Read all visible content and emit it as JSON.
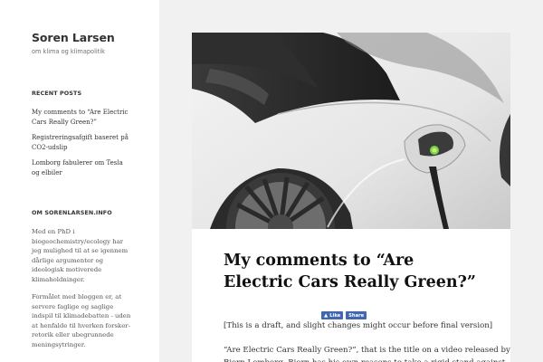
{
  "site": {
    "title": "Soren Larsen",
    "tagline": "om klima og klimapolitik"
  },
  "recent_posts": {
    "heading": "RECENT POSTS",
    "items": [
      "My comments to “Are Electric Cars Really Green?”",
      "Registreringsafgift baseret på CO2-udslip",
      "Lomborg fabulerer om Tesla og elbiler"
    ]
  },
  "about": {
    "heading": "OM SORENLARSEN.INFO",
    "paragraph1": "Med en PhD i biogeochemistry/ecology har jeg mulighed til at se igennem dårlige argumenter og ideologisk motiverede klimaholdninger.",
    "paragraph2": "Formålet med bloggen er, at servere faglige og saglige indspil til klimadebatten - uden at henfalde til hverken forsker-retorik eller ubegrunnede meningsytringer."
  },
  "article": {
    "title": "My comments to “Are Electric Cars Really Green?”",
    "like_label": "Like",
    "share_label": "Share",
    "intro": "[This is a draft, and slight changes might occur before final version]",
    "body": "“Are Electric Cars Really Green?”, that is the title on a video released by Bjorn Lomborg. Bjorn has his own reasons to take a rigid stand against"
  },
  "colors": {
    "page_background": "#f1f1f1",
    "panel_background": "#ffffff",
    "facebook_blue": "#4267b2",
    "charging_light": "#7fd14a"
  },
  "icons": {
    "facebook": "facebook-icon"
  }
}
